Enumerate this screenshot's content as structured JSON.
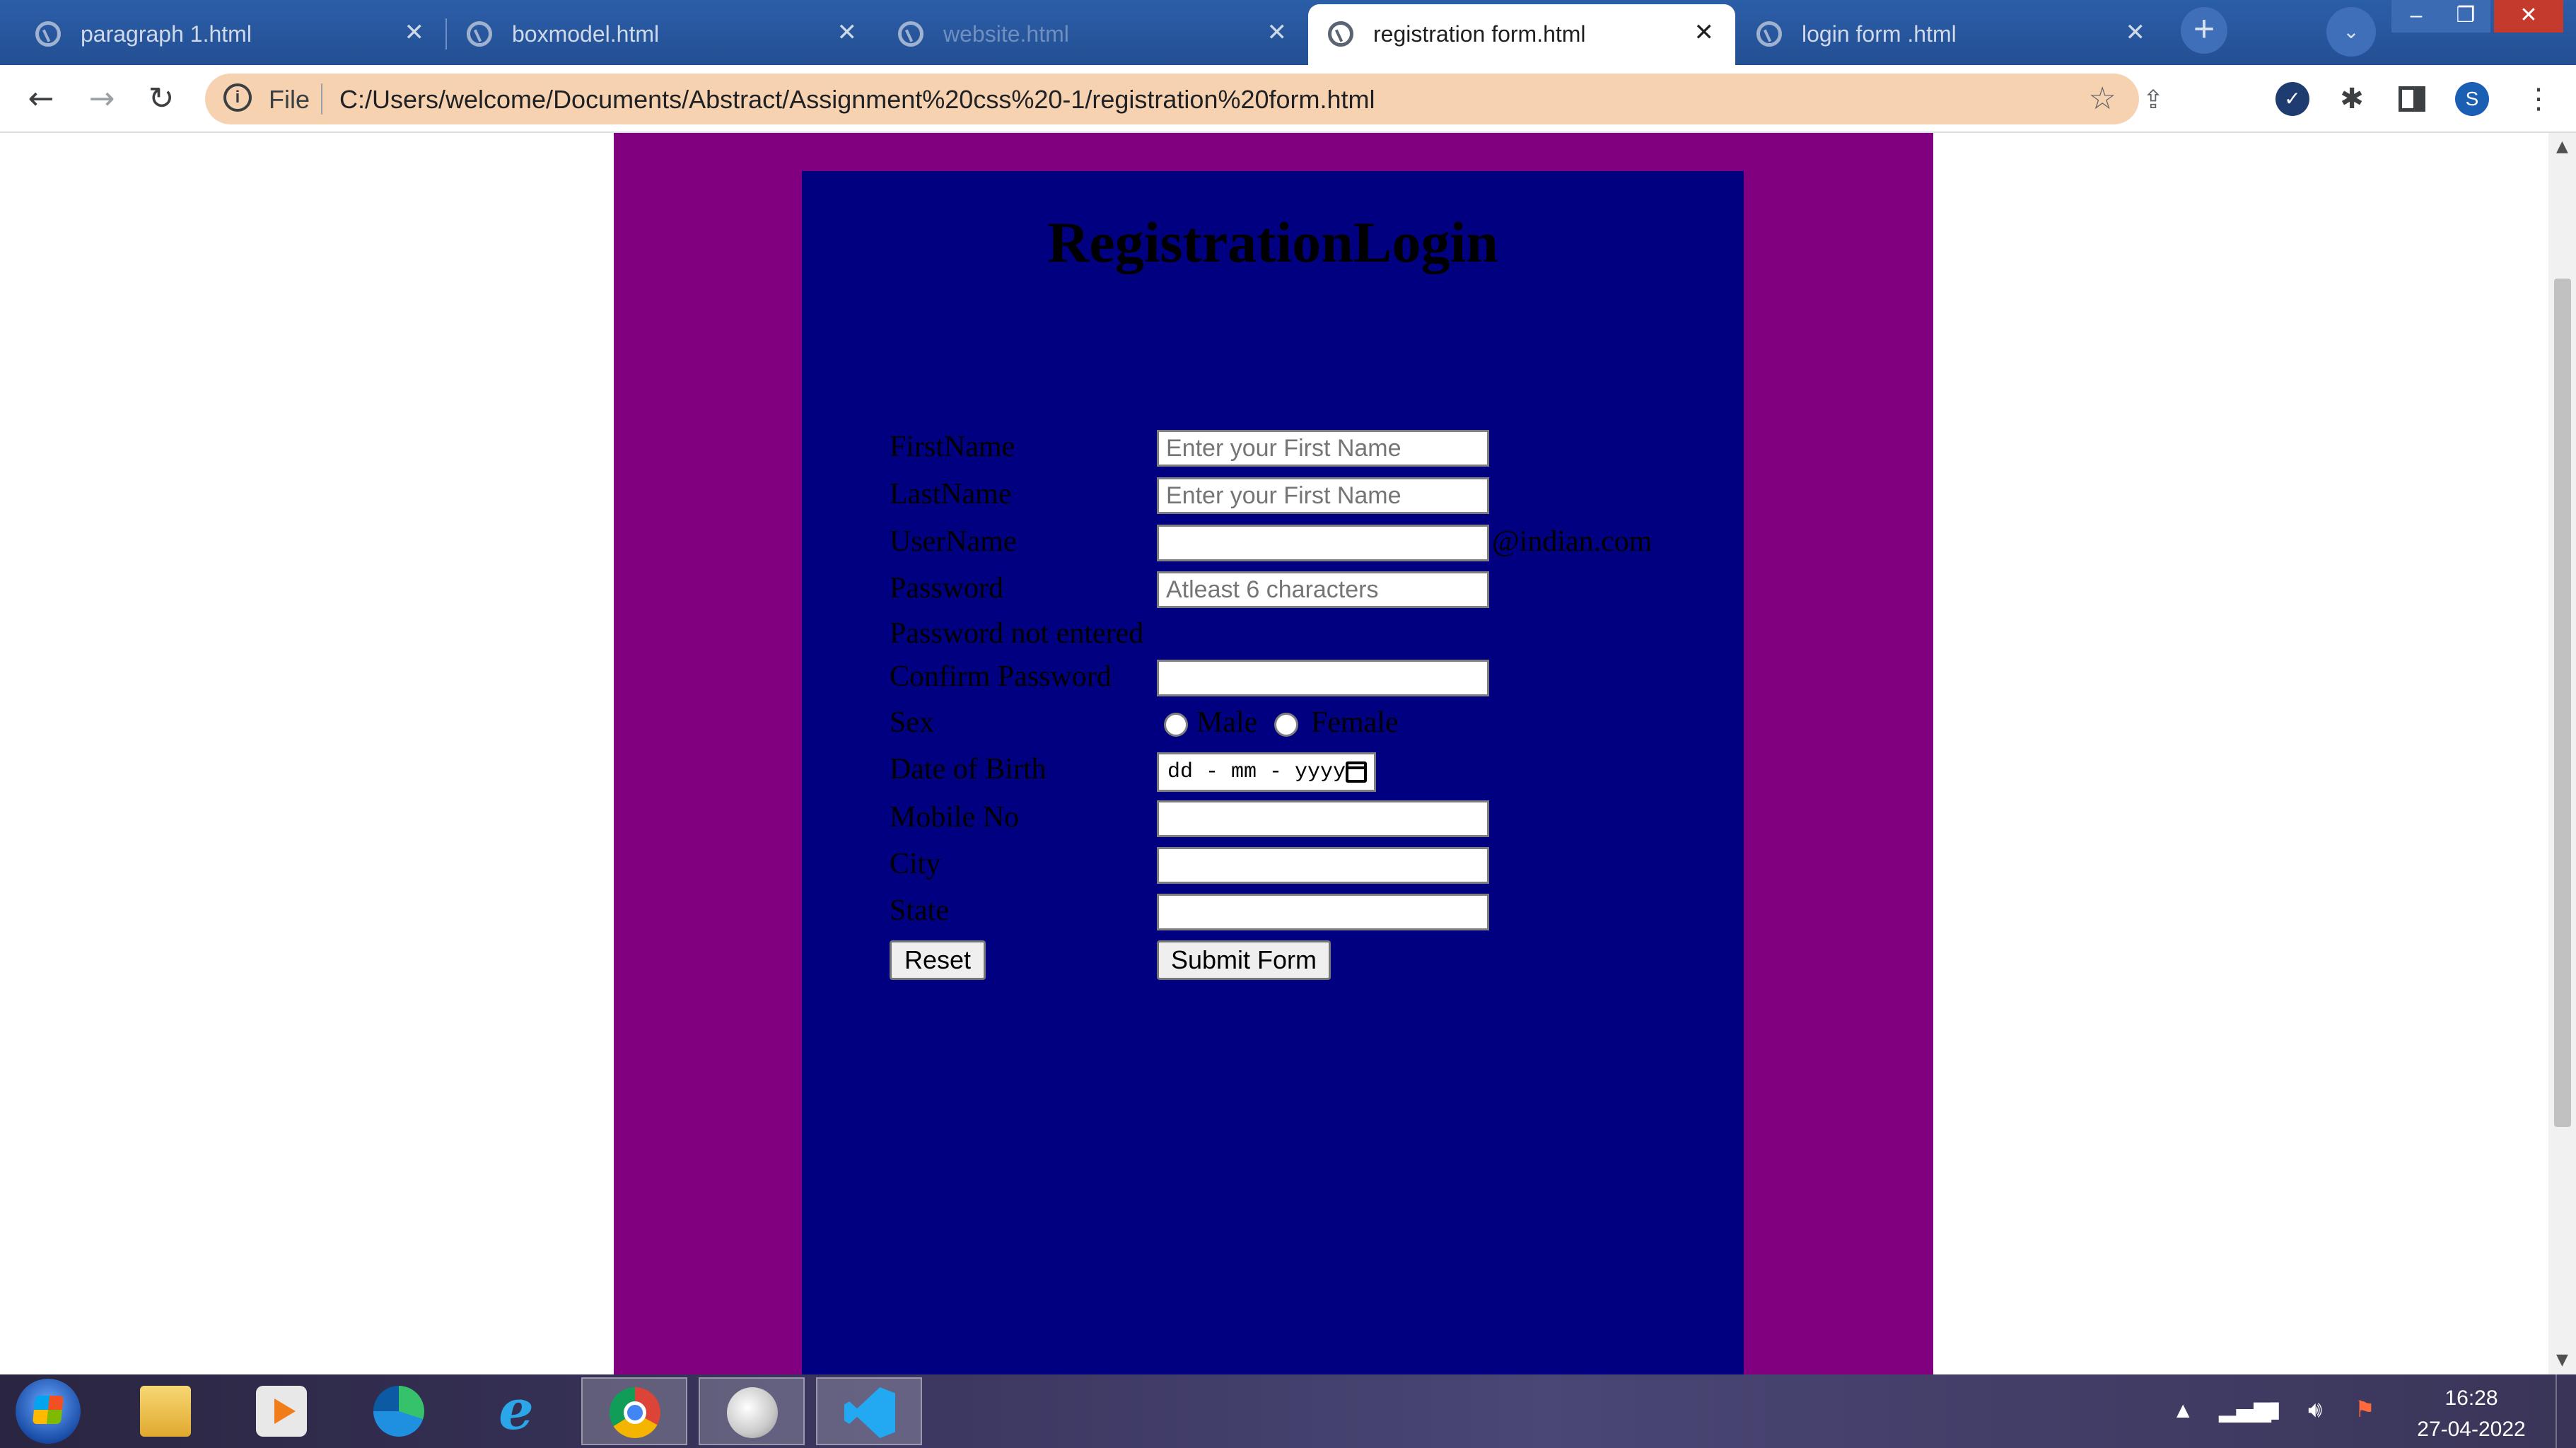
{
  "browser": {
    "tabs": [
      {
        "title": "paragraph 1.html",
        "active": false
      },
      {
        "title": "boxmodel.html",
        "active": false
      },
      {
        "title": "website.html",
        "active": false
      },
      {
        "title": "registration form.html",
        "active": true
      },
      {
        "title": "login form .html",
        "active": false
      }
    ],
    "address": {
      "scheme_label": "File",
      "url": "C:/Users/welcome/Documents/Abstract/Assignment%20css%20-1/registration%20form.html"
    },
    "profile_initial": "S"
  },
  "page": {
    "colors": {
      "outer_bg": "#800080",
      "inner_bg": "#000080",
      "text": "#000000"
    },
    "heading": "RegistrationLogin",
    "form": {
      "first_name": {
        "label": "FirstName",
        "placeholder": "Enter your First Name"
      },
      "last_name": {
        "label": "LastName",
        "placeholder": "Enter your First Name"
      },
      "user_name": {
        "label": "UserName",
        "suffix": "@indian.com"
      },
      "password": {
        "label": "Password",
        "placeholder": "Atleast 6 characters"
      },
      "password_note": "Password not entered",
      "confirm_password": {
        "label": "Confirm Password"
      },
      "sex": {
        "label": "Sex",
        "options": [
          "Male",
          "Female"
        ]
      },
      "dob": {
        "label": "Date of Birth",
        "placeholder": "dd - mm - yyyy"
      },
      "mobile": {
        "label": "Mobile No"
      },
      "city": {
        "label": "City"
      },
      "state": {
        "label": "State"
      },
      "reset_label": "Reset",
      "submit_label": "Submit Form"
    }
  },
  "taskbar": {
    "apps": [
      "start",
      "file-explorer",
      "media-player",
      "edge",
      "internet-explorer",
      "chrome",
      "paint",
      "vscode"
    ],
    "clock": {
      "time": "16:28",
      "date": "27-04-2022"
    }
  }
}
